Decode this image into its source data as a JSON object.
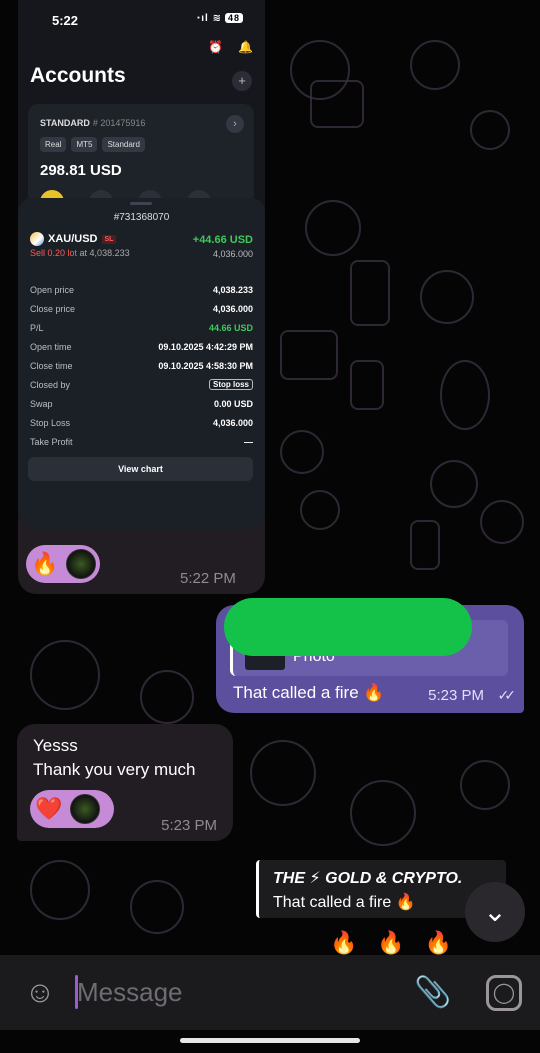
{
  "screenshot": {
    "status_time": "5:22",
    "status_signal": "‧ıl",
    "battery": "48",
    "accounts_title": "Accounts",
    "plus": "+",
    "card": {
      "kind": "STANDARD",
      "number": "# 201475916",
      "tags": [
        "Real",
        "MT5",
        "Standard"
      ],
      "balance": "298.81 USD"
    },
    "order": {
      "number": "#731368070",
      "symbol": "XAU/USD",
      "badge": "SL",
      "pl_top": "+44.66 USD",
      "sell_red": "Sell 0.20 lot",
      "sell_rest": "at 4,038.233",
      "close_top": "4,036.000",
      "rows": [
        {
          "label": "Open price",
          "value": "4,038.233"
        },
        {
          "label": "Close price",
          "value": "4,036.000"
        },
        {
          "label": "P/L",
          "value": "44.66 USD"
        },
        {
          "label": "Open time",
          "value": "09.10.2025 4:42:29 PM"
        },
        {
          "label": "Close time",
          "value": "09.10.2025 4:58:30 PM"
        },
        {
          "label": "Closed by",
          "value": "Stop loss"
        },
        {
          "label": "Swap",
          "value": "0.00 USD"
        },
        {
          "label": "Stop Loss",
          "value": "4,036.000"
        },
        {
          "label": "Take Profit",
          "value": "—"
        }
      ],
      "view_chart": "View chart"
    }
  },
  "photo_message": {
    "reaction": "🔥",
    "time": "5:22 PM"
  },
  "outgoing": {
    "quote_label": "Photo",
    "text": "That called a fire 🔥",
    "time": "5:23 PM",
    "checks": "✓✓"
  },
  "incoming": {
    "line1": "Yesss",
    "line2": "Thank you very much",
    "reaction": "❤️",
    "time": "5:23 PM"
  },
  "reply_preview": {
    "author": "THE ⚡ GOLD & CRYPTO.",
    "text": "That called a fire 🔥"
  },
  "fires": "🔥🔥🔥",
  "scroll_down": "⌄",
  "input": {
    "placeholder": "Message"
  },
  "colors": {
    "accent": "#5b4f9e",
    "reaction": "#c58bd6",
    "green": "#3ec95a",
    "red": "#ff5b5b"
  }
}
